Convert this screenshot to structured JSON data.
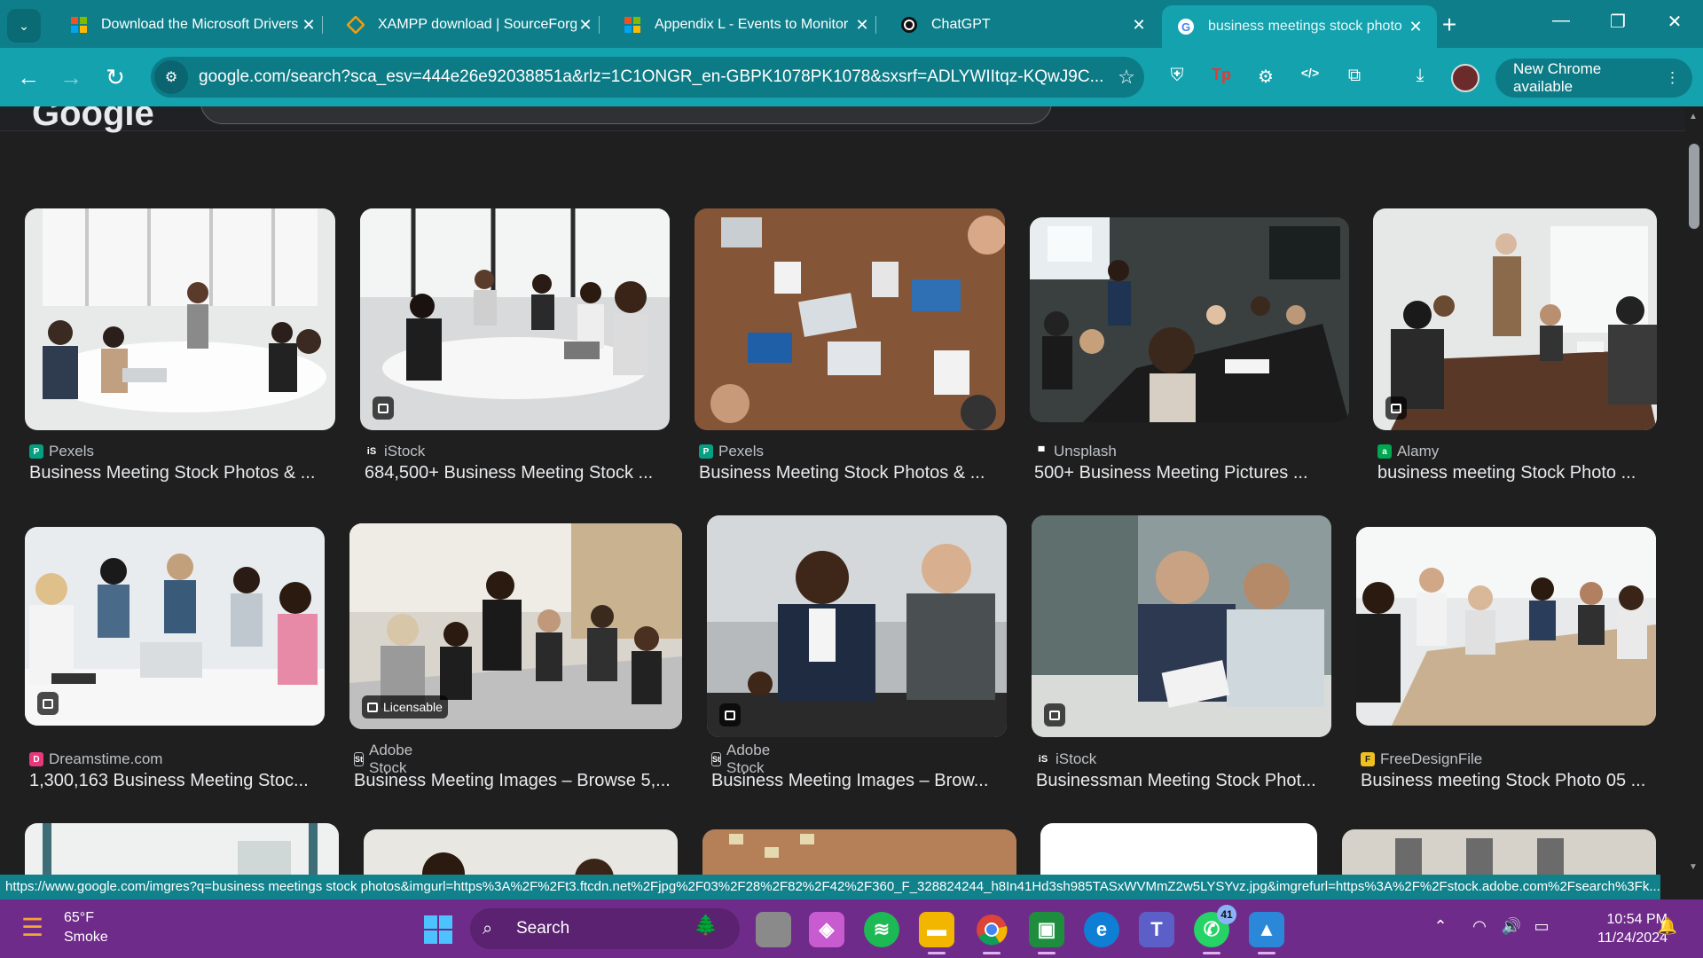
{
  "browser": {
    "tabs": [
      {
        "title": "Download the Microsoft Drivers",
        "icon": "microsoft-icon"
      },
      {
        "title": "XAMPP download | SourceForge",
        "icon": "sourceforge-icon"
      },
      {
        "title": "Appendix L - Events to Monitor",
        "icon": "microsoft-icon"
      },
      {
        "title": "ChatGPT",
        "icon": "chatgpt-icon"
      },
      {
        "title": "business meetings stock photo",
        "icon": "google-icon",
        "active": true
      }
    ],
    "url": "google.com/search?sca_esv=444e26e92038851a&rlz=1C1ONGR_en-GBPK1078PK1078&sxsrf=ADLYWIItqz-KQwJ9C...",
    "update_button": "New Chrome available",
    "status_url": "https://www.google.com/imgres?q=business meetings stock photos&imgurl=https%3A%2F%2Ft3.ftcdn.net%2Fjpg%2F03%2F28%2F82%2F42%2F360_F_328824244_h8In41Hd3sh985TASxWVMmZ2w5LYSYvz.jpg&imgrefurl=https%3A%2F%2Fstock.adobe.com%2Fsearch%3Fk..."
  },
  "google": {
    "logo": "Google"
  },
  "results": [
    {
      "source": "Pexels",
      "source_icon": "P",
      "source_color": "#05a081",
      "title": "Business Meeting Stock Photos & ...",
      "badge": ""
    },
    {
      "source": "iStock",
      "source_icon": "iS",
      "source_color": "#1f1f1f",
      "title": "684,500+ Business Meeting Stock ...",
      "badge": "icon"
    },
    {
      "source": "Pexels",
      "source_icon": "P",
      "source_color": "#05a081",
      "title": "Business Meeting Stock Photos & ...",
      "badge": ""
    },
    {
      "source": "Unsplash",
      "source_icon": "U",
      "source_color": "#1f1f1f",
      "title": "500+ Business Meeting Pictures ...",
      "badge": ""
    },
    {
      "source": "Alamy",
      "source_icon": "a",
      "source_color": "#00a651",
      "title": "business meeting Stock Photo ...",
      "badge": "icon"
    },
    {
      "source": "Dreamstime.com",
      "source_icon": "D",
      "source_color": "#e5397c",
      "title": "1,300,163 Business Meeting Stoc...",
      "badge": "icon"
    },
    {
      "source": "Adobe Stock",
      "source_icon": "St",
      "source_color": "#1f1f1f",
      "title": "Business Meeting Images – Browse 5,...",
      "badge": "Licensable"
    },
    {
      "source": "Adobe Stock",
      "source_icon": "St",
      "source_color": "#1f1f1f",
      "title": "Business Meeting Images – Brow...",
      "badge": "icon"
    },
    {
      "source": "iStock",
      "source_icon": "iS",
      "source_color": "#1f1f1f",
      "title": "Businessman Meeting Stock Phot...",
      "badge": "icon"
    },
    {
      "source": "FreeDesignFile",
      "source_icon": "F",
      "source_color": "#f0c020",
      "title": "Business meeting Stock Photo 05 ...",
      "badge": ""
    }
  ],
  "taskbar": {
    "weather_temp": "65°F",
    "weather_desc": "Smoke",
    "search_label": "Search",
    "time": "10:54 PM",
    "date": "11/24/2024",
    "whatsapp_badge": "41"
  }
}
